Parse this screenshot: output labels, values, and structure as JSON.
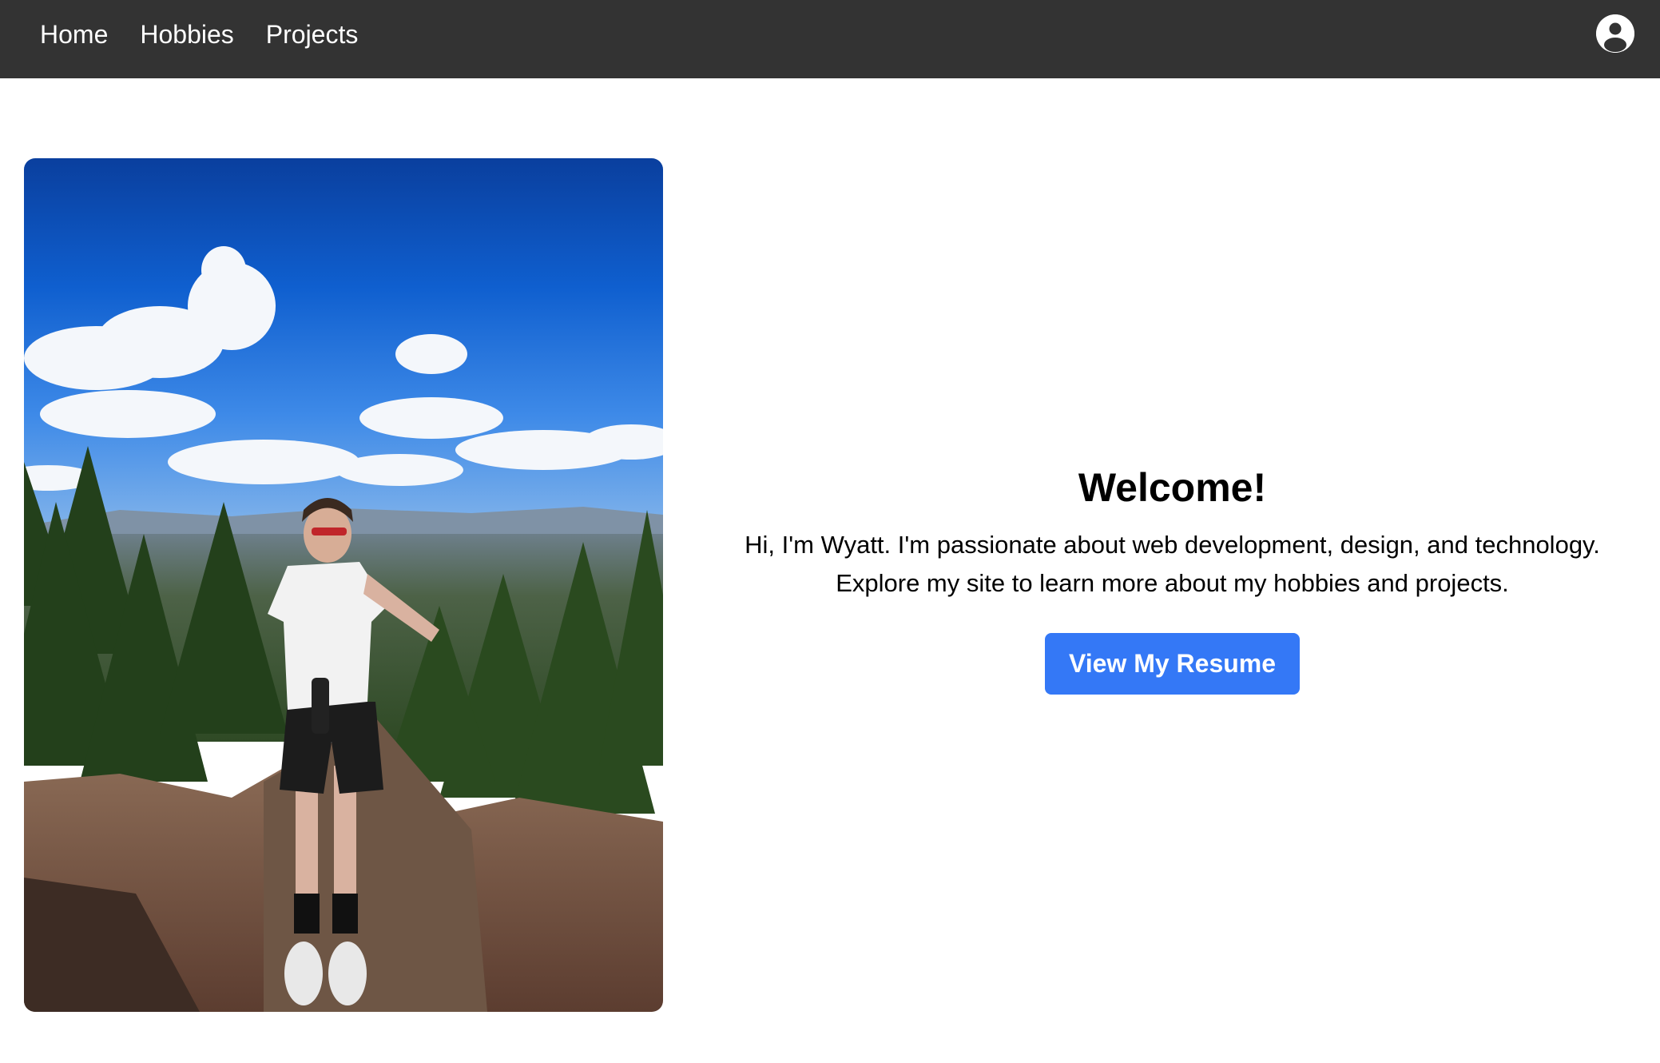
{
  "nav": {
    "links": [
      "Home",
      "Hobbies",
      "Projects"
    ],
    "profile_icon": "user-circle-icon"
  },
  "hero": {
    "title": "Welcome!",
    "intro_line1": "Hi, I'm Wyatt. I'm passionate about web development, design, and technology.",
    "intro_line2": "Explore my site to learn more about my hobbies and projects.",
    "resume_button": "View My Resume"
  },
  "colors": {
    "navbar": "#333333",
    "accent": "#3478f6",
    "background": "#ffffff"
  }
}
